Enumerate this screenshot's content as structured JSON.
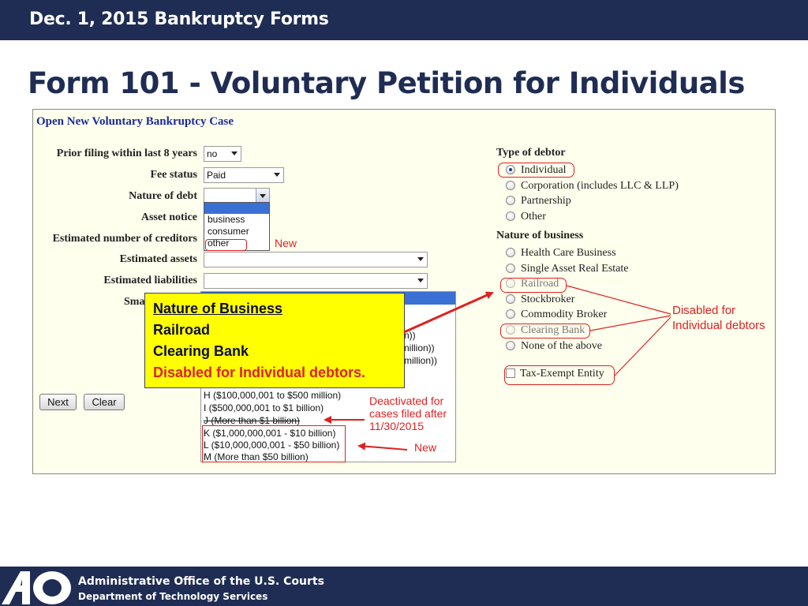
{
  "header": {
    "title": "Dec. 1, 2015 Bankruptcy Forms"
  },
  "slide": {
    "title": "Form 101 - Voluntary Petition for Individuals"
  },
  "form": {
    "heading": "Open New Voluntary Bankruptcy Case",
    "fields": {
      "prior_filing": {
        "label": "Prior filing within last 8 years",
        "value": "no"
      },
      "fee_status": {
        "label": "Fee status",
        "value": "Paid"
      },
      "nature_of_debt": {
        "label": "Nature of debt",
        "value": "",
        "options": [
          "business",
          "consumer",
          "other"
        ]
      },
      "asset_notice": {
        "label": "Asset notice"
      },
      "estimated_creditors": {
        "label": "Estimated number of creditors"
      },
      "estimated_assets": {
        "label": "Estimated assets",
        "value": ""
      },
      "estimated_liabilities": {
        "label": "Estimated liabilities",
        "value": ""
      },
      "small_business": {
        "label_fragment": "Sma"
      }
    },
    "liabilities_list": {
      "partial_items": [
        "n))",
        "nillion))",
        "million))"
      ],
      "items": [
        "H ($100,000,001 to $500 million)",
        "I ($500,000,001 to $1 billion)",
        "J (More than $1 billion)",
        "K ($1,000,000,001 - $10 billion)",
        "L ($10,000,000,001 - $50 billion)",
        "M (More than $50 billion)"
      ]
    },
    "buttons": {
      "next": "Next",
      "clear": "Clear"
    },
    "type_of_debtor": {
      "heading": "Type of debtor",
      "options": [
        "Individual",
        "Corporation (includes LLC & LLP)",
        "Partnership",
        "Other"
      ],
      "selected": "Individual"
    },
    "nature_of_business": {
      "heading": "Nature of business",
      "options": [
        "Health Care Business",
        "Single Asset Real Estate",
        "Railroad",
        "Stockbroker",
        "Commodity Broker",
        "Clearing Bank",
        "None of the above"
      ],
      "disabled": [
        "Railroad",
        "Clearing Bank"
      ]
    },
    "tax_exempt": {
      "label": "Tax-Exempt Entity"
    }
  },
  "annotations": {
    "new_label": "New",
    "new_label_2": "New",
    "callout": {
      "title": "Nature of Business",
      "line1": "Railroad",
      "line2": "Clearing Bank",
      "warning": "Disabled for Individual debtors."
    },
    "disabled_note": {
      "line1": "Disabled for",
      "line2": "Individual debtors"
    },
    "deactivated_note": {
      "line1": "Deactivated for",
      "line2": "cases filed after",
      "line3": "11/30/2015"
    }
  },
  "footer": {
    "line1": "Administrative Office of the U.S. Courts",
    "line2": "Department of Technology Services"
  },
  "colors": {
    "navy": "#1f2d54",
    "accent_red": "#e02020",
    "callout_yellow": "#ffff00",
    "panel_bg": "#ffffee",
    "link_blue": "#1a2a9a"
  }
}
